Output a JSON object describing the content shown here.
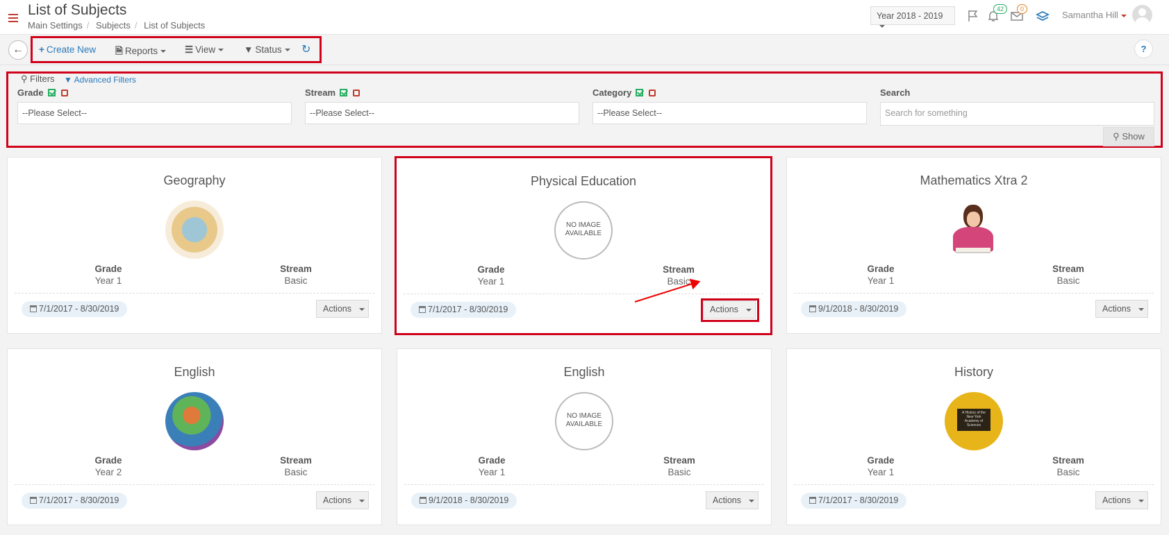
{
  "header": {
    "title": "List of Subjects",
    "breadcrumb": [
      "Main Settings",
      "Subjects",
      "List of Subjects"
    ],
    "year": "Year 2018 - 2019",
    "notifications_count": "42",
    "messages_count": "0",
    "user_name": "Samantha Hill",
    "icons": [
      "menu-icon",
      "flag-icon",
      "bell-icon",
      "envelope-icon",
      "layers-icon",
      "avatar"
    ]
  },
  "toolbar": {
    "create_new": "Create New",
    "reports": "Reports",
    "view": "View",
    "status": "Status",
    "help": "?"
  },
  "filters": {
    "title": "Filters",
    "advanced": "Advanced Filters",
    "grade_label": "Grade",
    "grade_value": "--Please Select--",
    "stream_label": "Stream",
    "stream_value": "--Please Select--",
    "category_label": "Category",
    "category_value": "--Please Select--",
    "search_label": "Search",
    "search_placeholder": "Search for something",
    "show_label": "Show"
  },
  "labels": {
    "grade": "Grade",
    "stream": "Stream",
    "actions": "Actions",
    "no_image": "NO IMAGE AVAILABLE"
  },
  "cards": [
    {
      "title": "Geography",
      "grade": "Year 1",
      "stream": "Basic",
      "dates": "7/1/2017 - 8/30/2019",
      "image": "geography-book"
    },
    {
      "title": "Physical Education",
      "grade": "Year 1",
      "stream": "Basic",
      "dates": "7/1/2017 - 8/30/2019",
      "image": "none"
    },
    {
      "title": "Mathematics Xtra 2",
      "grade": "Year 1",
      "stream": "Basic",
      "dates": "9/1/2018 - 8/30/2019",
      "image": "girl-reading"
    },
    {
      "title": "English",
      "grade": "Year 2",
      "stream": "Basic",
      "dates": "7/1/2017 - 8/30/2019",
      "image": "english-book"
    },
    {
      "title": "English",
      "grade": "Year 1",
      "stream": "Basic",
      "dates": "9/1/2018 - 8/30/2019",
      "image": "none"
    },
    {
      "title": "History",
      "grade": "Year 1",
      "stream": "Basic",
      "dates": "7/1/2017 - 8/30/2019",
      "image": "history-book"
    }
  ],
  "history_cover_text": "A History of the New York Academy of Sciences",
  "colors": {
    "accent": "#2a7ab8",
    "highlight": "#d0021b",
    "brand_red": "#c0392b"
  }
}
